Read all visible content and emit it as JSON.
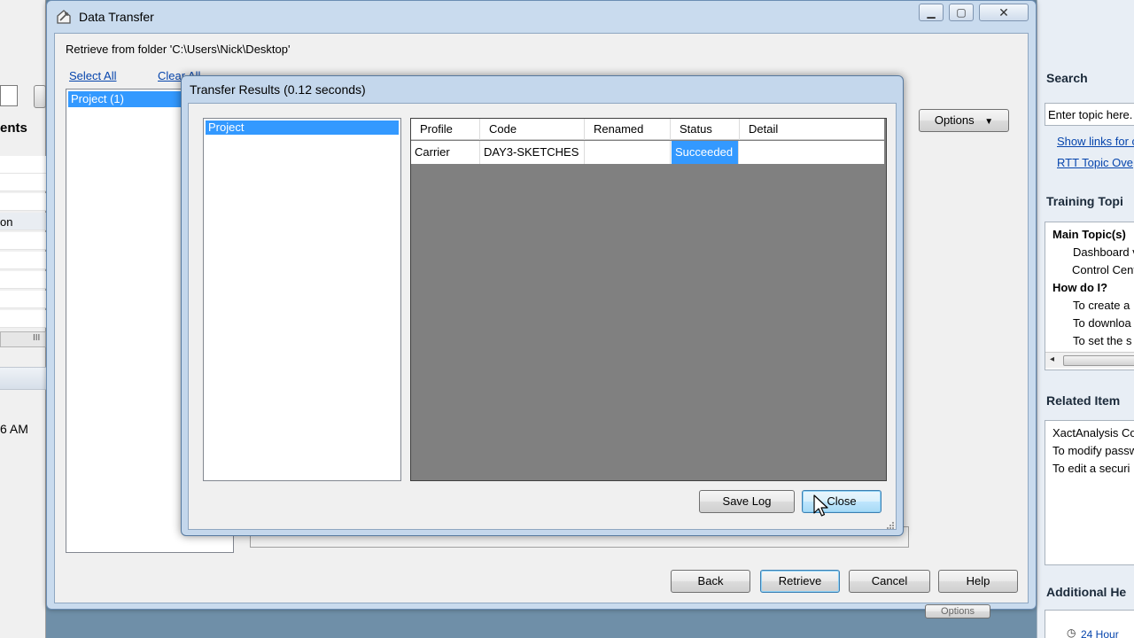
{
  "background_left": {
    "heading_fragment": "ents",
    "row_fragment": "on",
    "time_fragment": "6 AM",
    "scroll_glyph": "III"
  },
  "background_right": {
    "search_title": "Search",
    "search_placeholder": "Enter topic here.",
    "search_links": [
      "Show links for c",
      "RTT Topic Ove"
    ],
    "training_title": "Training Topi",
    "training_items": [
      {
        "text": "Main Topic(s)",
        "bold": true
      },
      {
        "text": "Dashboard v",
        "bold": false
      },
      {
        "text": "Control Cent",
        "bold": false
      },
      {
        "text": "How do I?",
        "bold": true
      },
      {
        "text": "To create a",
        "bold": false
      },
      {
        "text": "To downloa",
        "bold": false
      },
      {
        "text": "To set the s",
        "bold": false
      }
    ],
    "related_title": "Related Item",
    "related_items": [
      "XactAnalysis Co",
      "To modify passw",
      "To edit a securi"
    ],
    "additional_title": "Additional He",
    "additional_item": "24 Hour"
  },
  "main_window": {
    "title": "Data Transfer",
    "folder_label": "Retrieve from folder 'C:\\Users\\Nick\\Desktop'",
    "select_all": "Select All",
    "clear_all": "Clear All",
    "project_item": "Project (1)",
    "options_button": "Options",
    "back_button": "Back",
    "retrieve_button": "Retrieve",
    "cancel_button": "Cancel",
    "help_button": "Help",
    "hidden_button": "Options"
  },
  "dialog": {
    "title": "Transfer Results (0.12 seconds)",
    "tree_item": "Project",
    "columns": [
      "Profile",
      "Code",
      "Renamed",
      "Status",
      "Detail"
    ],
    "rows": [
      {
        "profile": "Carrier",
        "code": "DAY3-SKETCHES",
        "renamed": "",
        "status": "Succeeded",
        "detail": ""
      }
    ],
    "save_log_button": "Save Log",
    "close_button": "Close"
  },
  "colors": {
    "selection": "#3399ff",
    "grid_background": "#808080",
    "title_bar": "#c9dbee",
    "link": "#0645ad"
  }
}
